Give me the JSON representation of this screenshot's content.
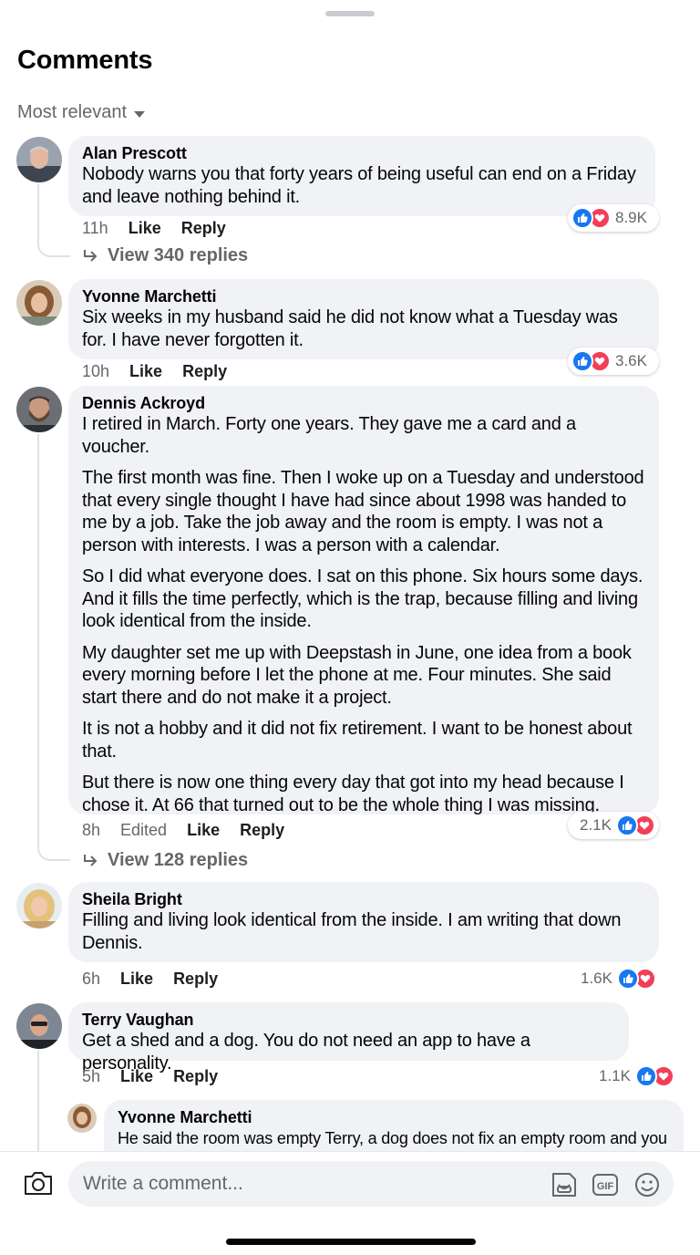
{
  "header": {
    "title": "Comments",
    "sort_label": "Most relevant"
  },
  "comments": [
    {
      "name": "Alan Prescott",
      "text": "Nobody warns you that forty years of being useful can end on a Friday and leave nothing behind it.",
      "time": "11h",
      "like": "Like",
      "reply": "Reply",
      "reactions": "8.9K",
      "view_replies": "View 340 replies"
    },
    {
      "name": "Yvonne Marchetti",
      "text": "Six weeks in my husband said he did not know what a Tuesday was for. I have never forgotten it.",
      "time": "10h",
      "like": "Like",
      "reply": "Reply",
      "reactions": "3.6K"
    },
    {
      "name": "Dennis Ackroyd",
      "paragraphs": [
        "I retired in March. Forty one years. They gave me a card and a voucher.",
        "The first month was fine. Then I woke up on a Tuesday and understood that every single thought I have had since about 1998 was handed to me by a job. Take the job away and the room is empty. I was not a person with interests. I was a person with a calendar.",
        "So I did what everyone does. I sat on this phone. Six hours some days. And it fills the time perfectly, which is the trap, because filling and living look identical from the inside.",
        "My daughter set me up with Deepstash in June, one idea from a book every morning before I let the phone at me. Four minutes. She said start there and do not make it a project.",
        "It is not a hobby and it did not fix retirement. I want to be honest about that.",
        "But there is now one thing every day that got into my head because I chose it. At 66 that turned out to be the whole thing I was missing."
      ],
      "time": "8h",
      "edited": "Edited",
      "like": "Like",
      "reply": "Reply",
      "reactions": "2.1K",
      "view_replies": "View 128 replies"
    },
    {
      "name": "Sheila Bright",
      "text": "Filling and living look identical from the inside. I am writing that down Dennis.",
      "time": "6h",
      "like": "Like",
      "reply": "Reply",
      "reactions": "1.6K"
    },
    {
      "name": "Terry Vaughan",
      "text": "Get a shed and a dog. You do not need an app to have a personality.",
      "time": "5h",
      "like": "Like",
      "reply": "Reply",
      "reactions": "1.1K"
    }
  ],
  "nested_reply": {
    "name": "Yvonne Marchetti",
    "text": "He said the room was empty Terry, a dog does not fix an empty room and you"
  },
  "composer": {
    "placeholder": "Write a comment..."
  },
  "icons": {
    "sort": "chevron-down-icon",
    "camera": "camera-icon",
    "sticker": "sticker-icon",
    "gif": "gif-icon",
    "emoji": "emoji-icon",
    "like": "like-reaction-icon",
    "love": "love-reaction-icon",
    "reply_arrow": "reply-arrow-icon"
  },
  "colors": {
    "like": "#1877f2",
    "love": "#f33e58",
    "bubble": "#f0f2f5",
    "muted": "#65676b"
  }
}
